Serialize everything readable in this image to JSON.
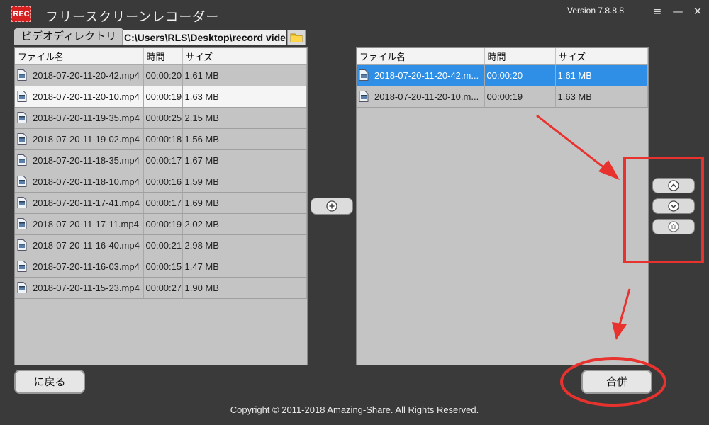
{
  "app": {
    "logo_text": "REC",
    "title": "フリースクリーンレコーダー",
    "version": "Version 7.8.8.8",
    "menu_icon": "≡",
    "minimize_icon": "—",
    "close_icon": "✕"
  },
  "directory": {
    "label": "ビデオディレクトリ",
    "path": "C:\\Users\\RLS\\Desktop\\record videos"
  },
  "table_headers": {
    "name": "ファイル名",
    "time": "時間",
    "size": "サイズ"
  },
  "left_files": [
    {
      "name": "2018-07-20-11-20-42.mp4",
      "time": "00:00:20",
      "size": "1.61 MB"
    },
    {
      "name": "2018-07-20-11-20-10.mp4",
      "time": "00:00:19",
      "size": "1.63 MB"
    },
    {
      "name": "2018-07-20-11-19-35.mp4",
      "time": "00:00:25",
      "size": "2.15 MB"
    },
    {
      "name": "2018-07-20-11-19-02.mp4",
      "time": "00:00:18",
      "size": "1.56 MB"
    },
    {
      "name": "2018-07-20-11-18-35.mp4",
      "time": "00:00:17",
      "size": "1.67 MB"
    },
    {
      "name": "2018-07-20-11-18-10.mp4",
      "time": "00:00:16",
      "size": "1.59 MB"
    },
    {
      "name": "2018-07-20-11-17-41.mp4",
      "time": "00:00:17",
      "size": "1.69 MB"
    },
    {
      "name": "2018-07-20-11-17-11.mp4",
      "time": "00:00:19",
      "size": "2.02 MB"
    },
    {
      "name": "2018-07-20-11-16-40.mp4",
      "time": "00:00:21",
      "size": "2.98 MB"
    },
    {
      "name": "2018-07-20-11-16-03.mp4",
      "time": "00:00:15",
      "size": "1.47 MB"
    },
    {
      "name": "2018-07-20-11-15-23.mp4",
      "time": "00:00:27",
      "size": "1.90 MB"
    }
  ],
  "right_files": [
    {
      "name": "2018-07-20-11-20-42.m...",
      "time": "00:00:20",
      "size": "1.61 MB"
    },
    {
      "name": "2018-07-20-11-20-10.m...",
      "time": "00:00:19",
      "size": "1.63 MB"
    }
  ],
  "buttons": {
    "back": "に戻る",
    "merge": "合併"
  },
  "icons": {
    "add": "plus-circle-icon",
    "move_up": "chevron-up-circle-icon",
    "move_down": "chevron-down-circle-icon",
    "delete": "trash-circle-icon",
    "folder": "folder-icon",
    "file": "video-file-icon"
  },
  "colors": {
    "background": "#3a3a3a",
    "panel": "#c4c4c4",
    "selected_row": "#2f8fe6",
    "annotation": "#e8322e",
    "logo": "#d61f1f"
  },
  "footer": {
    "copyright": "Copyright © 2011-2018 Amazing-Share. All Rights Reserved."
  }
}
